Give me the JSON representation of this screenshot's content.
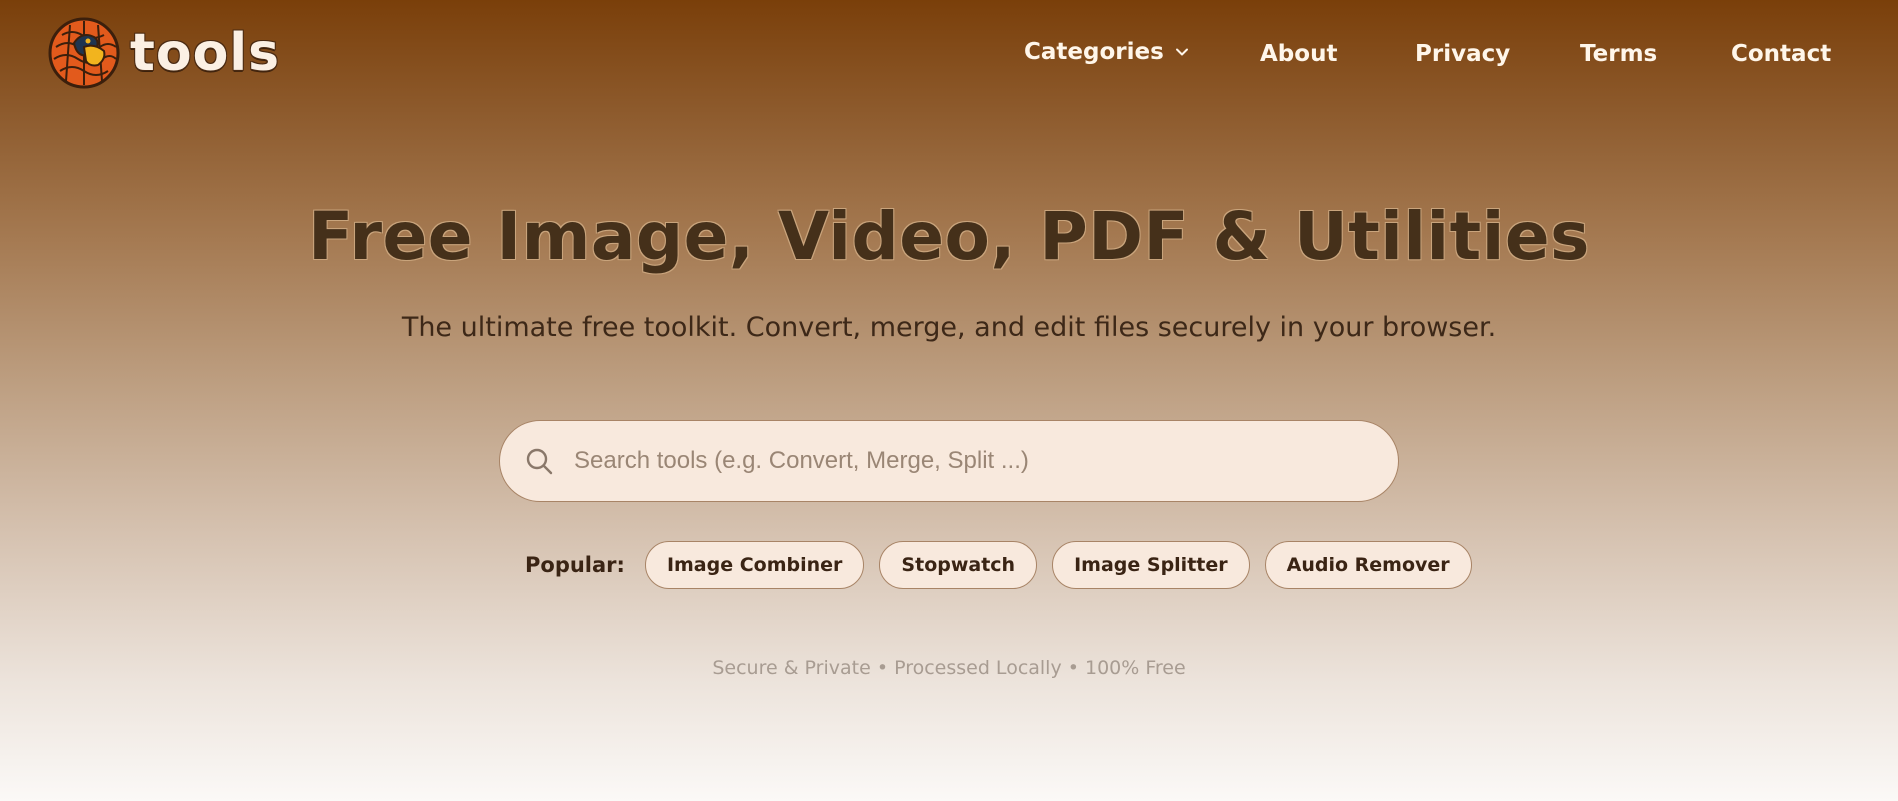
{
  "header": {
    "brand_name": "tools",
    "logo_icon": "pangolin-logo-icon",
    "nav": {
      "categories_label": "Categories",
      "about_label": "About",
      "privacy_label": "Privacy",
      "terms_label": "Terms",
      "contact_label": "Contact"
    }
  },
  "hero": {
    "title": "Free Image, Video, PDF & Utilities",
    "subtitle": "The ultimate free toolkit. Convert, merge, and edit files securely in your browser."
  },
  "search": {
    "placeholder": "Search tools (e.g. Convert, Merge, Split ...)",
    "value": ""
  },
  "popular": {
    "label": "Popular:",
    "items": [
      {
        "label": "Image Combiner"
      },
      {
        "label": "Stopwatch"
      },
      {
        "label": "Image Splitter"
      },
      {
        "label": "Audio Remover"
      }
    ]
  },
  "trust_line": "Secure & Private • Processed Locally • 100% Free",
  "colors": {
    "header_top": "#7a3f0a",
    "title_text": "#45301a",
    "nav_text": "#fff6ea",
    "search_bg": "#f8e9dd",
    "chip_border": "#a88466"
  }
}
